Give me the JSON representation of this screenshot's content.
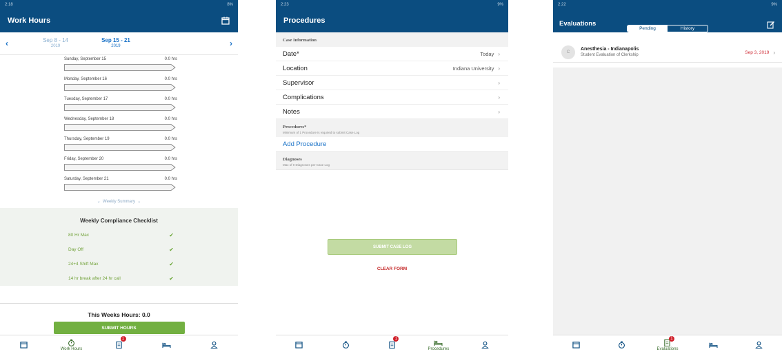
{
  "p1": {
    "status_time": "2:18",
    "status_right": "8%",
    "title": "Work Hours",
    "prev_week": {
      "range": "Sep 8 - 14",
      "year": "2019"
    },
    "cur_week": {
      "range": "Sep 15 - 21",
      "year": "2019"
    },
    "days": [
      {
        "label": "Sunday, September 15",
        "hours": "0.0 hrs"
      },
      {
        "label": "Monday, September 16",
        "hours": "0.0 hrs"
      },
      {
        "label": "Tuesday, September 17",
        "hours": "0.0 hrs"
      },
      {
        "label": "Wednesday, September 18",
        "hours": "0.0 hrs"
      },
      {
        "label": "Thursday, September 19",
        "hours": "0.0 hrs"
      },
      {
        "label": "Friday, September 20",
        "hours": "0.0 hrs"
      },
      {
        "label": "Saturday, September 21",
        "hours": "0.0 hrs"
      }
    ],
    "weekly_summary": "Weekly Summary",
    "checklist_title": "Weekly Compliance Checklist",
    "checklist": [
      "80 Hr Max",
      "Day Off",
      "24+4 Shift Max",
      "14 hr break after 24 hr call"
    ],
    "this_weeks_hours": "This Weeks Hours: 0.0",
    "submit": "SUBMIT HOURS",
    "tab_label": "Work Hours"
  },
  "p2": {
    "status_time": "2:23",
    "status_right": "9%",
    "title": "Procedures",
    "case_info": "Case Information",
    "rows": [
      {
        "label": "Date*",
        "value": "Today"
      },
      {
        "label": "Location",
        "value": "Indiana University"
      },
      {
        "label": "Supervisor",
        "value": ""
      },
      {
        "label": "Complications",
        "value": ""
      },
      {
        "label": "Notes",
        "value": ""
      }
    ],
    "procedures_head": "Procedures*",
    "procedures_sub": "Minimum of 1 Procedure is required to submit Case Log",
    "add_procedure": "Add Procedure",
    "diagnoses_head": "Diagnoses",
    "diagnoses_sub": "Max of 0 Diagnoses per Case Log",
    "submit": "SUBMIT CASE LOG",
    "clear": "CLEAR FORM",
    "tab_label": "Procedures"
  },
  "p3": {
    "status_time": "2:22",
    "status_right": "9%",
    "title": "Evaluations",
    "seg_pending": "Pending",
    "seg_history": "History",
    "eval_title": "Anesthesia - Indianapolis",
    "eval_sub": "Student Evaluation of Clerkship",
    "eval_date": "Sep 3, 2019",
    "avatar": "C",
    "tab_label": "Evaluations"
  },
  "badge": "1",
  "colors": {
    "header": "#0b4d80",
    "accent": "#1a72c7",
    "green": "#72b041",
    "red": "#d0303a"
  }
}
